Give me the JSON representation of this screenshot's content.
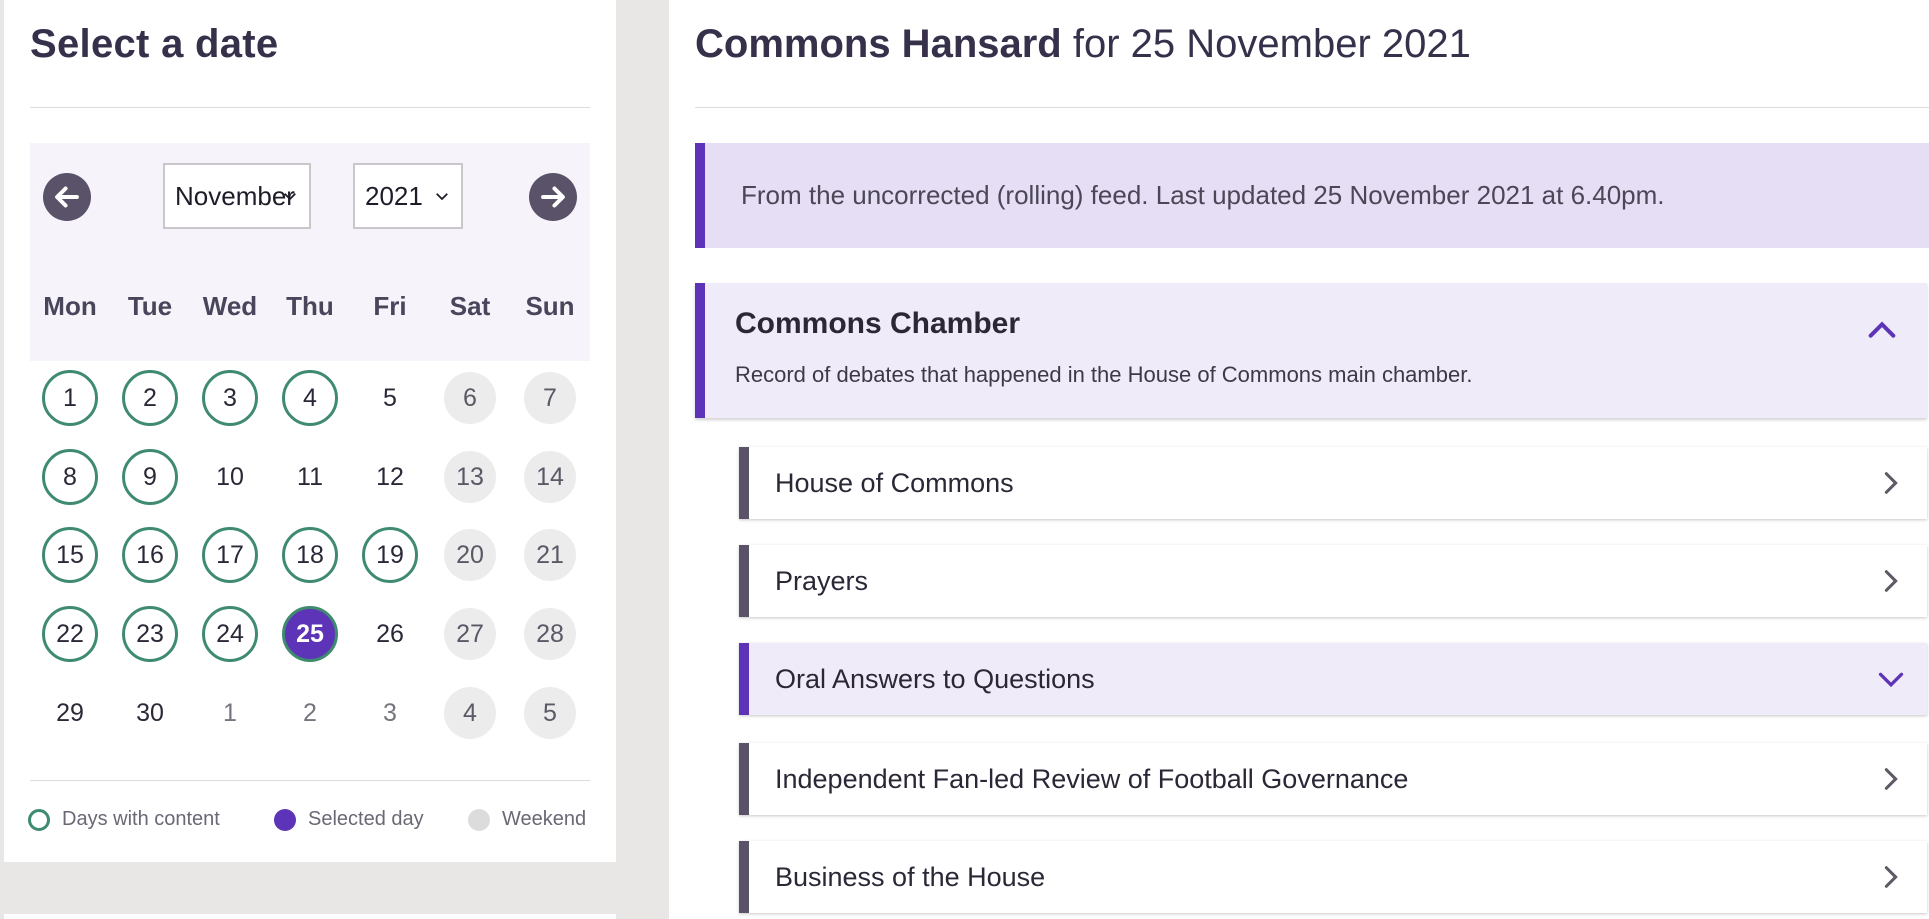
{
  "left": {
    "title": "Select a date",
    "month_select": "November",
    "year_select": "2021",
    "weekdays": [
      "Mon",
      "Tue",
      "Wed",
      "Thu",
      "Fri",
      "Sat",
      "Sun"
    ],
    "weeks": [
      [
        {
          "d": "1",
          "t": "content"
        },
        {
          "d": "2",
          "t": "content"
        },
        {
          "d": "3",
          "t": "content"
        },
        {
          "d": "4",
          "t": "content"
        },
        {
          "d": "5",
          "t": "plain"
        },
        {
          "d": "6",
          "t": "weekend"
        },
        {
          "d": "7",
          "t": "weekend"
        }
      ],
      [
        {
          "d": "8",
          "t": "content"
        },
        {
          "d": "9",
          "t": "content"
        },
        {
          "d": "10",
          "t": "plain"
        },
        {
          "d": "11",
          "t": "plain"
        },
        {
          "d": "12",
          "t": "plain"
        },
        {
          "d": "13",
          "t": "weekend"
        },
        {
          "d": "14",
          "t": "weekend"
        }
      ],
      [
        {
          "d": "15",
          "t": "content"
        },
        {
          "d": "16",
          "t": "content"
        },
        {
          "d": "17",
          "t": "content"
        },
        {
          "d": "18",
          "t": "content"
        },
        {
          "d": "19",
          "t": "content"
        },
        {
          "d": "20",
          "t": "weekend"
        },
        {
          "d": "21",
          "t": "weekend"
        }
      ],
      [
        {
          "d": "22",
          "t": "content"
        },
        {
          "d": "23",
          "t": "content"
        },
        {
          "d": "24",
          "t": "content"
        },
        {
          "d": "25",
          "t": "selected"
        },
        {
          "d": "26",
          "t": "plain"
        },
        {
          "d": "27",
          "t": "weekend"
        },
        {
          "d": "28",
          "t": "weekend"
        }
      ],
      [
        {
          "d": "29",
          "t": "plain"
        },
        {
          "d": "30",
          "t": "plain"
        },
        {
          "d": "1",
          "t": "other"
        },
        {
          "d": "2",
          "t": "other"
        },
        {
          "d": "3",
          "t": "other"
        },
        {
          "d": "4",
          "t": "weekend"
        },
        {
          "d": "5",
          "t": "weekend"
        }
      ]
    ],
    "legend": {
      "content": "Days with content",
      "selected": "Selected day",
      "weekend": "Weekend"
    }
  },
  "right": {
    "title_bold": "Commons Hansard",
    "title_rest": " for 25 November 2021",
    "notice": "From the uncorrected (rolling) feed. Last updated 25 November 2021 at 6.40pm.",
    "section": {
      "title": "Commons Chamber",
      "description": "Record of debates that happened in the House of Commons main chamber."
    },
    "items": [
      {
        "label": "House of Commons",
        "state": "closed"
      },
      {
        "label": "Prayers",
        "state": "closed"
      },
      {
        "label": "Oral Answers to Questions",
        "state": "open"
      },
      {
        "label": "Independent Fan-led Review of Football Governance",
        "state": "closed"
      },
      {
        "label": "Business of the House",
        "state": "closed"
      }
    ]
  },
  "colors": {
    "accent_purple": "#5d34b8",
    "content_green": "#3f8b6f",
    "nav_dark": "#5a5268",
    "panel_lilac": "#efebf8"
  }
}
